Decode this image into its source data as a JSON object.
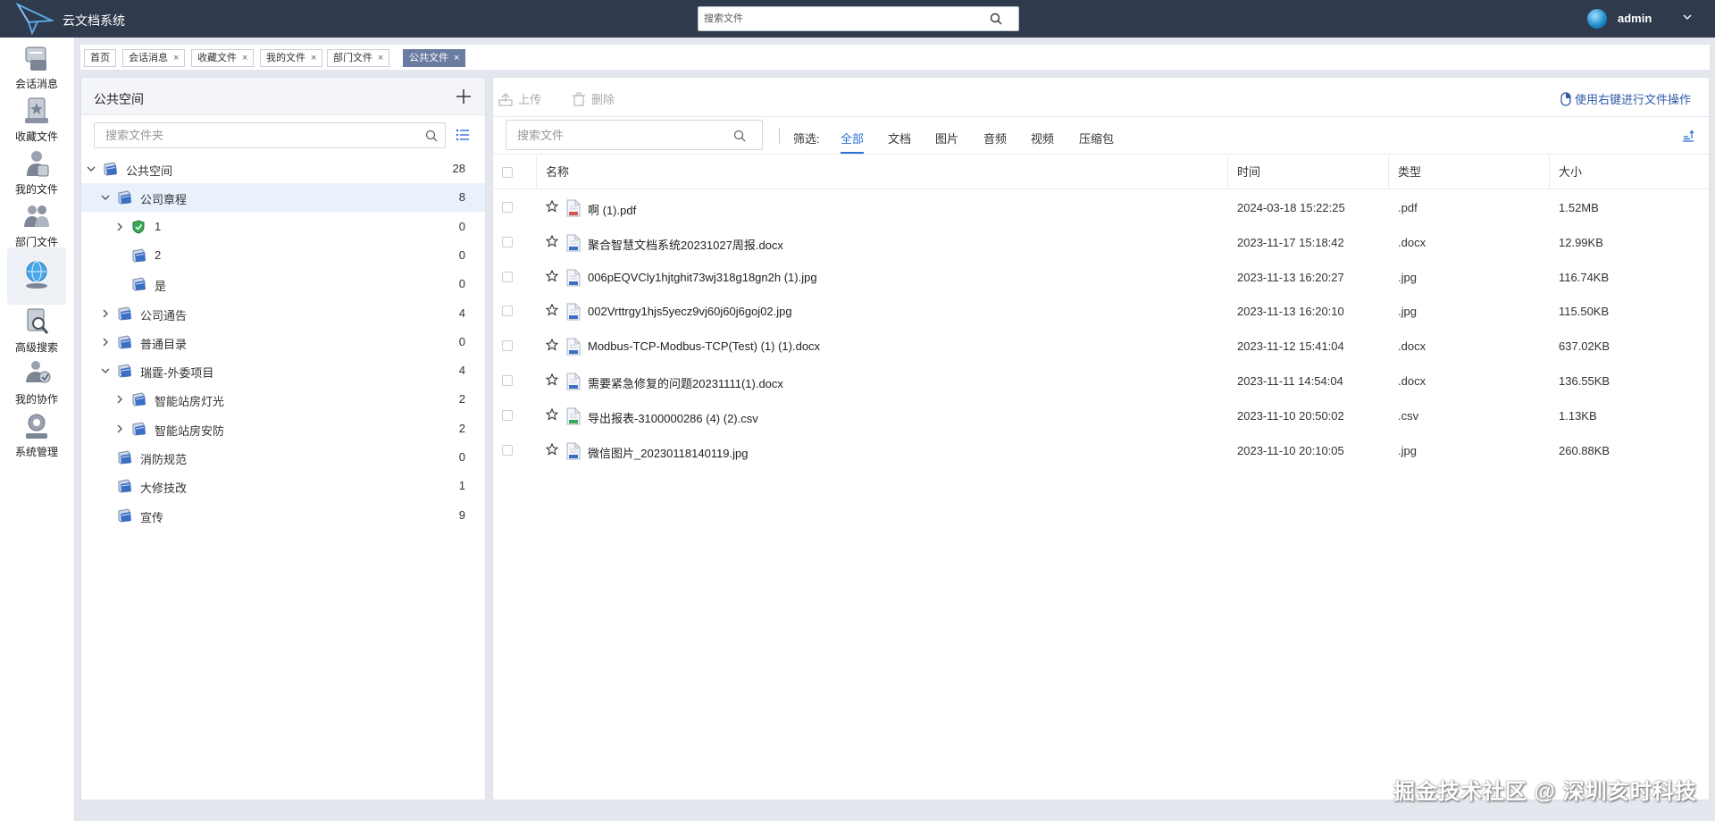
{
  "app": {
    "title": "云文档系统",
    "top_search_placeholder": "搜索文件",
    "username": "admin"
  },
  "nav": [
    {
      "label": "会话消息",
      "icon": "chat-message-icon"
    },
    {
      "label": "收藏文件",
      "icon": "favorite-files-icon"
    },
    {
      "label": "我的文件",
      "icon": "my-files-icon"
    },
    {
      "label": "部门文件",
      "icon": "department-files-icon"
    },
    {
      "label": "",
      "icon": "public-space-globe-icon"
    },
    {
      "label": "高级搜索",
      "icon": "advanced-search-icon"
    },
    {
      "label": "我的协作",
      "icon": "collaboration-icon"
    },
    {
      "label": "系统管理",
      "icon": "system-admin-icon"
    }
  ],
  "tabs": [
    {
      "label": "首页",
      "closable": false
    },
    {
      "label": "会话消息",
      "closable": true
    },
    {
      "label": "收藏文件",
      "closable": true
    },
    {
      "label": "我的文件",
      "closable": true
    },
    {
      "label": "部门文件",
      "closable": true
    },
    {
      "label": "公共文件",
      "closable": true,
      "active": true
    }
  ],
  "folder_panel": {
    "title": "公共空间",
    "search_placeholder": "搜索文件夹",
    "tree": [
      {
        "label": "公共空间",
        "count": "28",
        "level": 0,
        "expander": "expanded"
      },
      {
        "label": "公司章程",
        "count": "8",
        "level": 1,
        "expander": "expanded",
        "selected": true
      },
      {
        "label": "1",
        "count": "0",
        "level": 2,
        "expander": "collapsed",
        "shield": true
      },
      {
        "label": "2",
        "count": "0",
        "level": 2,
        "expander": "none"
      },
      {
        "label": "是",
        "count": "0",
        "level": 2,
        "expander": "none"
      },
      {
        "label": "公司通告",
        "count": "4",
        "level": 1,
        "expander": "collapsed"
      },
      {
        "label": "普通目录",
        "count": "0",
        "level": 1,
        "expander": "collapsed"
      },
      {
        "label": "瑞霆-外委项目",
        "count": "4",
        "level": 1,
        "expander": "expanded"
      },
      {
        "label": "智能站房灯光",
        "count": "2",
        "level": 2,
        "expander": "collapsed"
      },
      {
        "label": "智能站房安防",
        "count": "2",
        "level": 2,
        "expander": "collapsed"
      },
      {
        "label": "消防规范",
        "count": "0",
        "level": 1,
        "expander": "none"
      },
      {
        "label": "大修技改",
        "count": "1",
        "level": 1,
        "expander": "none"
      },
      {
        "label": "宣传",
        "count": "9",
        "level": 1,
        "expander": "none"
      }
    ]
  },
  "toolbar": {
    "upload_label": "上传",
    "delete_label": "删除",
    "hint": "使用右键进行文件操作"
  },
  "filter": {
    "search_placeholder": "搜索文件",
    "label": "筛选:",
    "tabs": [
      "全部",
      "文档",
      "图片",
      "音频",
      "视频",
      "压缩包"
    ],
    "active": "全部"
  },
  "table": {
    "columns": [
      "名称",
      "时间",
      "类型",
      "大小"
    ],
    "rows": [
      {
        "name": "啊 (1).pdf",
        "time": "2024-03-18 15:22:25",
        "type": ".pdf",
        "size": "1.52MB",
        "kind": "pdf"
      },
      {
        "name": "聚合智慧文档系统20231027周报.docx",
        "time": "2023-11-17 15:18:42",
        "type": ".docx",
        "size": "12.99KB",
        "kind": "doc"
      },
      {
        "name": "006pEQVCly1hjtghit73wj318g18gn2h (1).jpg",
        "time": "2023-11-13 16:20:27",
        "type": ".jpg",
        "size": "116.74KB",
        "kind": "img"
      },
      {
        "name": "002Vrttrgy1hjs5yecz9vj60j60j6goj02.jpg",
        "time": "2023-11-13 16:20:10",
        "type": ".jpg",
        "size": "115.50KB",
        "kind": "img"
      },
      {
        "name": "Modbus-TCP-Modbus-TCP(Test) (1) (1).docx",
        "time": "2023-11-12 15:41:04",
        "type": ".docx",
        "size": "637.02KB",
        "kind": "doc"
      },
      {
        "name": "需要紧急修复的问题20231111(1).docx",
        "time": "2023-11-11 14:54:04",
        "type": ".docx",
        "size": "136.55KB",
        "kind": "doc"
      },
      {
        "name": "导出报表-3100000286 (4) (2).csv",
        "time": "2023-11-10 20:50:02",
        "type": ".csv",
        "size": "1.13KB",
        "kind": "csv"
      },
      {
        "name": "微信图片_20230118140119.jpg",
        "time": "2023-11-10 20:10:05",
        "type": ".jpg",
        "size": "260.88KB",
        "kind": "img"
      }
    ]
  },
  "watermark": "掘金技术社区 @ 深圳亥时科技",
  "colors": {
    "topbar": "#2f3a4c",
    "accent": "#2f6fd6",
    "active_tab": "#6b7ca3",
    "selected_row": "#e8f1fc"
  }
}
